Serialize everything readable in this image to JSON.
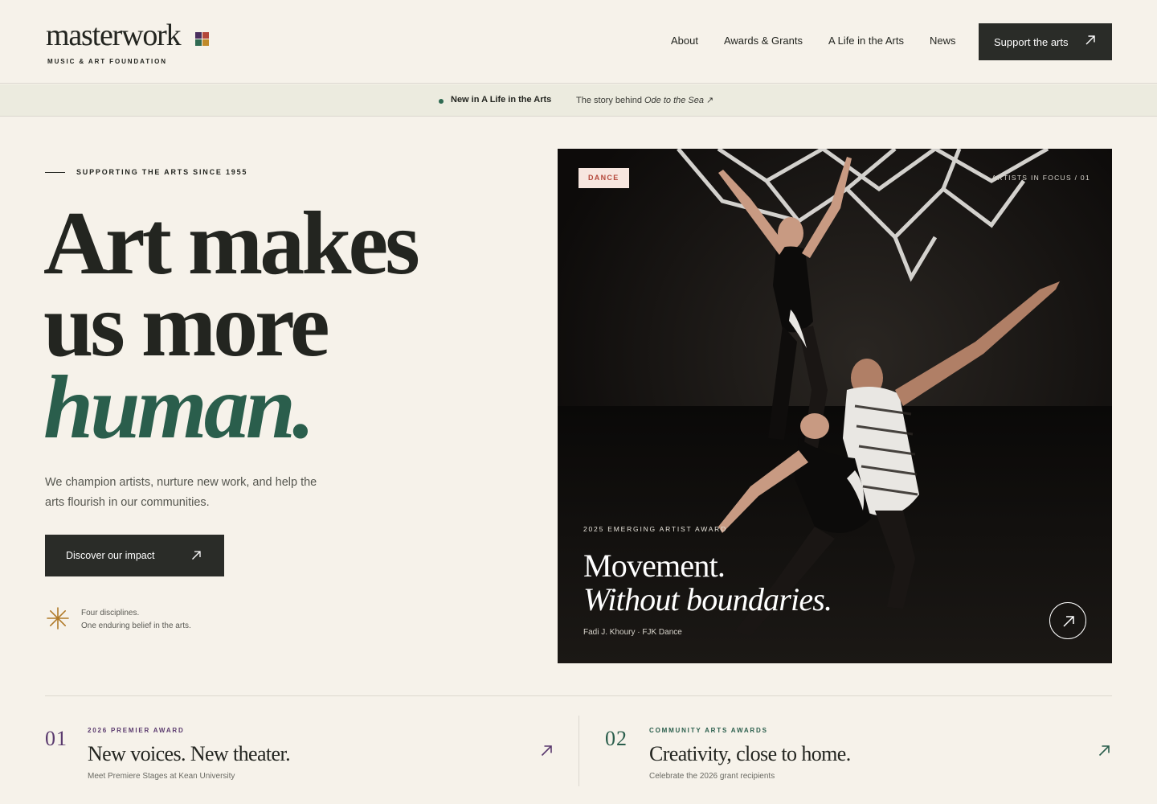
{
  "brand": {
    "wordmark": "masterwork",
    "subtitle": "MUSIC & ART FOUNDATION"
  },
  "nav": {
    "items": [
      {
        "label": "About"
      },
      {
        "label": "Awards & Grants"
      },
      {
        "label": "A Life in the Arts"
      },
      {
        "label": "News"
      }
    ],
    "cta_label": "Support the arts"
  },
  "announcement": {
    "tag": "New in A Life in the Arts",
    "text_prefix": "The story behind ",
    "text_title": "Ode to the Sea",
    "text_suffix": " ↗"
  },
  "hero": {
    "eyebrow": "SUPPORTING THE ARTS SINCE 1955",
    "headline_1": "Art makes",
    "headline_2": "us more",
    "headline_3": "human.",
    "body": "We champion artists, nurture new work, and help the arts flourish in our communities.",
    "cta_label": "Discover our impact",
    "tagline_1": "Four disciplines.",
    "tagline_2": "One enduring belief in the arts."
  },
  "feature": {
    "badge": "DANCE",
    "focus": "ARTISTS IN FOCUS  /  01",
    "award": "2025 EMERGING ARTIST AWARD",
    "title_1": "Movement.",
    "title_2": "Without boundaries.",
    "credit": "Fadi J. Khoury · FJK Dance"
  },
  "cards": [
    {
      "number": "01",
      "eyebrow": "2026 PREMIER AWARD",
      "title": "New voices. New theater.",
      "subtitle": "Meet Premiere Stages at Kean University"
    },
    {
      "number": "02",
      "eyebrow": "COMMUNITY ARTS AWARDS",
      "title": "Creativity, close to home.",
      "subtitle": "Celebrate the 2026 grant recipients"
    }
  ],
  "colors": {
    "background": "#f6f2ea",
    "ink": "#232520",
    "accent_green": "#2a5e4c",
    "accent_purple": "#5a3a6e",
    "accent_gold": "#b07a28",
    "badge_red": "#b4473a"
  },
  "icons": {
    "support_arrow": "arrow-up-right-icon",
    "cta_arrow": "arrow-up-right-icon",
    "tagline": "asterisk-icon",
    "feature_button": "arrow-up-right-icon",
    "card_arrow": "arrow-up-right-icon"
  }
}
